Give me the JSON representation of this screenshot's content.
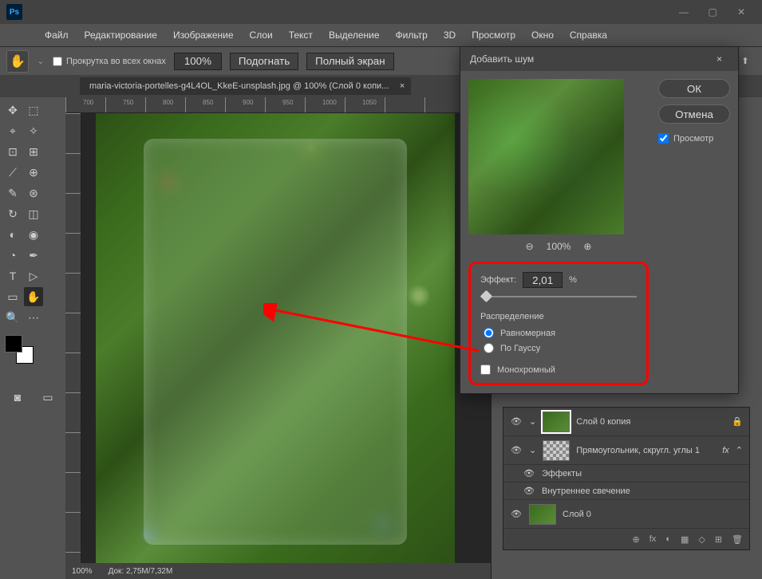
{
  "app": {
    "name": "Ps"
  },
  "titlebar": {
    "min": "―",
    "max": "▢",
    "close": "✕"
  },
  "menu": [
    "Файл",
    "Редактирование",
    "Изображение",
    "Слои",
    "Текст",
    "Выделение",
    "Фильтр",
    "3D",
    "Просмотр",
    "Окно",
    "Справка"
  ],
  "options": {
    "scroll_all": "Прокрутка во всех окнах",
    "zoom": "100%",
    "fit": "Подогнать",
    "full": "Полный экран"
  },
  "tab": {
    "label": "maria-victoria-portelles-g4L4OL_KkeE-unsplash.jpg @ 100% (Слой 0 копи..."
  },
  "ruler": [
    "700",
    "750",
    "800",
    "850",
    "900",
    "950",
    "1000",
    "1050"
  ],
  "status": {
    "zoom": "100%",
    "doc": "Док: 2,75M/7,32M"
  },
  "dialog": {
    "title": "Добавить шум",
    "ok": "ОК",
    "cancel": "Отмена",
    "preview_label": "Просмотр",
    "preview_zoom": "100%",
    "effect_label": "Эффект:",
    "effect_value": "2,01",
    "effect_unit": "%",
    "dist_label": "Распределение",
    "dist_uniform": "Равномерная",
    "dist_gauss": "По Гауссу",
    "mono": "Монохромный"
  },
  "layers": {
    "items": [
      {
        "name": "Слой 0 копия",
        "locked": true,
        "active": true,
        "thumb": "green"
      },
      {
        "name": "Прямоугольник, скругл. углы 1 ",
        "fx": true,
        "thumb": "checker"
      },
      {
        "name": "Слой 0",
        "thumb": "green"
      }
    ],
    "fx_label": "Эффекты",
    "fx_item": "Внутреннее свечение",
    "footer_icons": [
      "⊕",
      "fx",
      "◐",
      "▦",
      "◇",
      "⊞",
      "🗑"
    ]
  }
}
